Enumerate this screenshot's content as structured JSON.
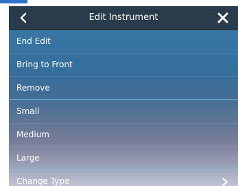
{
  "header": {
    "title": "Edit Instrument",
    "back_icon": "chevron-left-icon",
    "close_icon": "close-icon"
  },
  "menu": {
    "items": [
      {
        "label": "End Edit"
      },
      {
        "label": "Bring to Front"
      },
      {
        "label": "Remove"
      },
      {
        "label": "Small"
      },
      {
        "label": "Medium"
      },
      {
        "label": "Large"
      },
      {
        "label": "Change Type",
        "icon": "chevron-right-icon"
      }
    ]
  },
  "colors": {
    "accent": "#2f72c9",
    "header_bg": "#2a3c4b",
    "separator_highlight": "#7fd0ee"
  }
}
